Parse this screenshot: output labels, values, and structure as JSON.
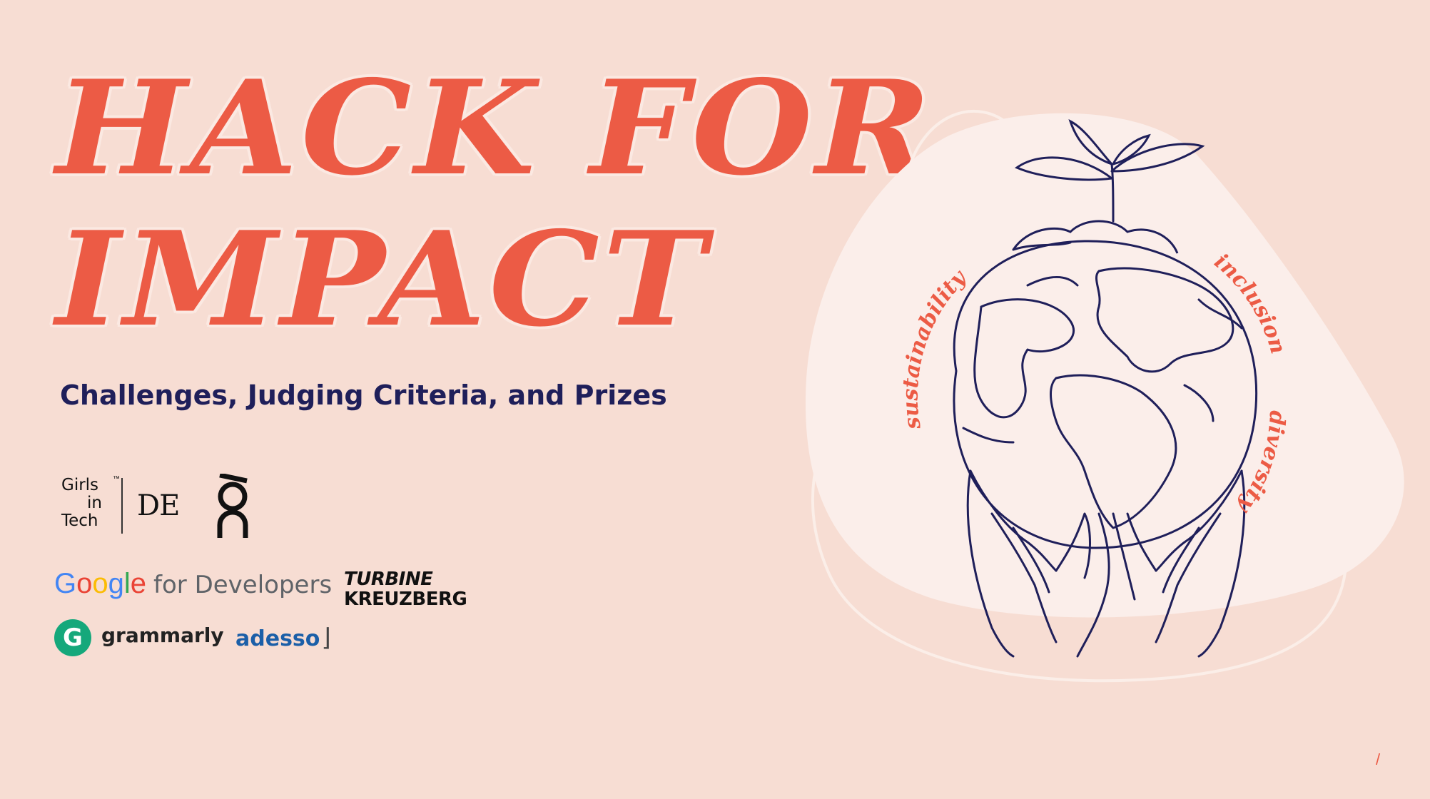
{
  "title": {
    "line1": "HACK FOR",
    "line2": "IMPACT"
  },
  "subtitle": "Challenges, Judging Criteria, and Prizes",
  "logos": {
    "girls_in_tech": {
      "line1": "Girls",
      "line2": "in",
      "line3": "Tech",
      "trademark": "™",
      "region": "DE"
    },
    "google": {
      "letters": [
        "G",
        "o",
        "o",
        "g",
        "l",
        "e"
      ],
      "colors": [
        "#4285f4",
        "#ea4335",
        "#fbbc05",
        "#4285f4",
        "#34a853",
        "#ea4335"
      ],
      "suffix": "for Developers"
    },
    "turbine": {
      "line1": "TURBINE",
      "line2": "KREUZBERG"
    },
    "grammarly": {
      "mark": "G",
      "name": "grammarly"
    },
    "adesso": {
      "name": "adesso"
    }
  },
  "illustration": {
    "words": [
      "sustainability",
      "inclusion",
      "diversity"
    ]
  },
  "page_marker": "/",
  "colors": {
    "background": "#f7ddd3",
    "accent": "#ec5b45",
    "navy": "#1f1f5a",
    "blob": "#fbeeea",
    "line_art": "#1f1f5a"
  }
}
